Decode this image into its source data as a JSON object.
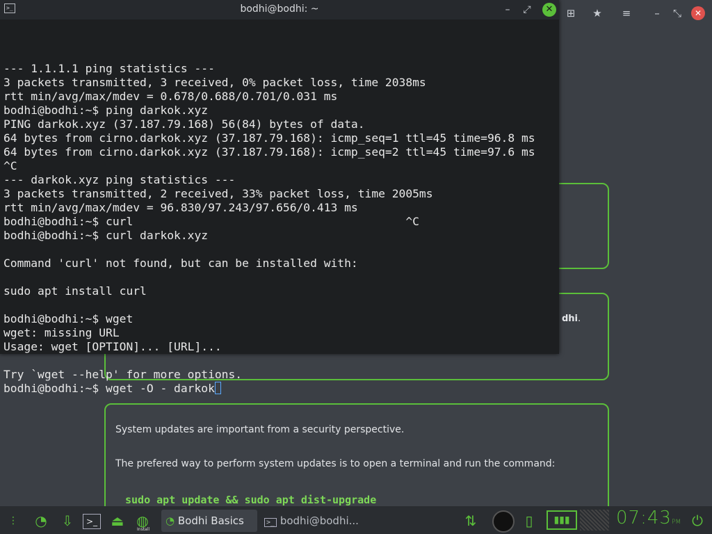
{
  "terminal": {
    "title": "bodhi@bodhi: ~",
    "lines": [
      "--- 1.1.1.1 ping statistics ---",
      "3 packets transmitted, 3 received, 0% packet loss, time 2038ms",
      "rtt min/avg/max/mdev = 0.678/0.688/0.701/0.031 ms",
      "bodhi@bodhi:~$ ping darkok.xyz",
      "PING darkok.xyz (37.187.79.168) 56(84) bytes of data.",
      "64 bytes from cirno.darkok.xyz (37.187.79.168): icmp_seq=1 ttl=45 time=96.8 ms",
      "64 bytes from cirno.darkok.xyz (37.187.79.168): icmp_seq=2 ttl=45 time=97.6 ms",
      "^C",
      "--- darkok.xyz ping statistics ---",
      "3 packets transmitted, 2 received, 33% packet loss, time 2005ms",
      "rtt min/avg/max/mdev = 96.830/97.243/97.656/0.413 ms",
      "bodhi@bodhi:~$ curl                                        ^C",
      "bodhi@bodhi:~$ curl darkok.xyz",
      "",
      "Command 'curl' not found, but can be installed with:",
      "",
      "sudo apt install curl",
      "",
      "bodhi@bodhi:~$ wget",
      "wget: missing URL",
      "Usage: wget [OPTION]... [URL]...",
      "",
      "Try `wget --help' for more options."
    ],
    "prompt_line": "bodhi@bodhi:~$ wget -O - darkok"
  },
  "background": {
    "card2_fragment_bold": "dhi",
    "card2_fragment_tail": ".",
    "card3_line1": "System updates are important from a security perspective.",
    "card3_line2": "The prefered way to perform system updates is to open a terminal and run the command:",
    "card3_command": "sudo apt update && sudo apt dist-upgrade"
  },
  "taskbar": {
    "tasks": [
      {
        "label": "Bodhi Basics"
      },
      {
        "label": "bodhi@bodhi..."
      }
    ],
    "install_label": "Install",
    "clock": "07:43",
    "clock_ampm": "PM"
  },
  "colors": {
    "accent": "#5bbf3a",
    "terminal_bg": "#1d1f21",
    "desktop_bg": "#3b3f45"
  },
  "icons": [
    "terminal-icon",
    "minimize-icon",
    "maximize-icon",
    "close-icon",
    "add-tab-icon",
    "bookmark-icon",
    "menu-icon",
    "moksha-logo-icon",
    "download-icon",
    "launcher-icon",
    "workspace-icon",
    "network-icon",
    "media-icon",
    "clipboard-icon",
    "battery-icon",
    "power-icon"
  ]
}
